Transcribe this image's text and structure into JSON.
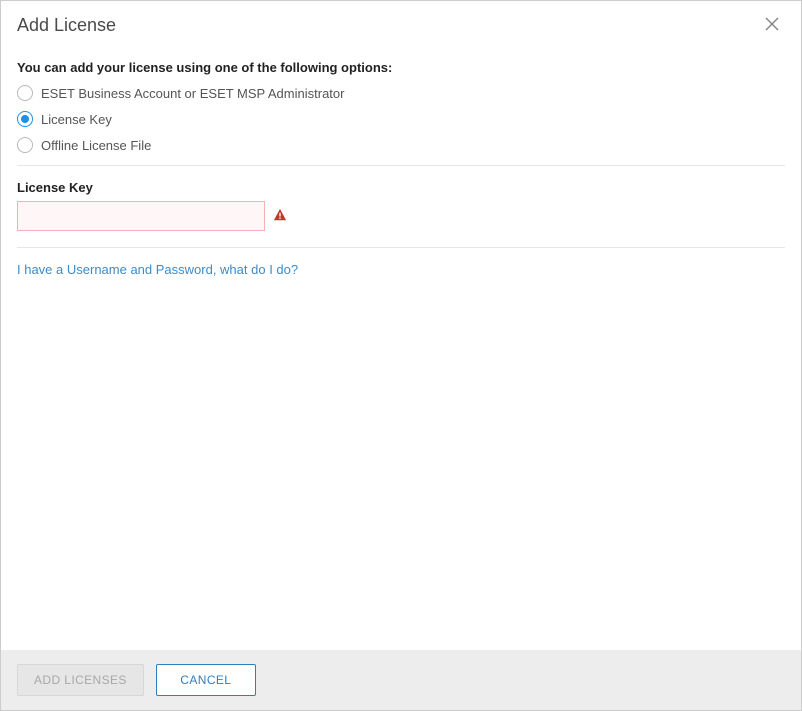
{
  "dialog": {
    "title": "Add License",
    "intro": "You can add your license using one of the following options:",
    "options": [
      {
        "label": "ESET Business Account or ESET MSP Administrator",
        "selected": false
      },
      {
        "label": "License Key",
        "selected": true
      },
      {
        "label": "Offline License File",
        "selected": false
      }
    ],
    "field": {
      "label": "License Key",
      "value": "",
      "placeholder": ""
    },
    "help_link": "I have a Username and Password, what do I do?",
    "buttons": {
      "add": "ADD LICENSES",
      "cancel": "CANCEL"
    }
  }
}
